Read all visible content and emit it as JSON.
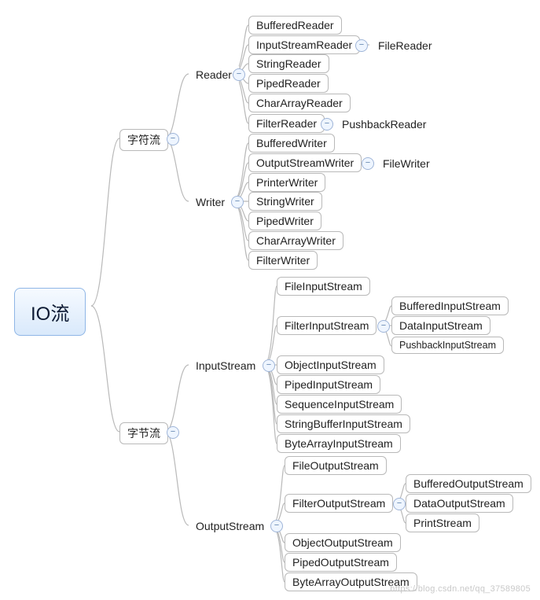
{
  "root": {
    "label": "IO流"
  },
  "charStream": {
    "label": "字符流"
  },
  "reader": {
    "label": "Reader"
  },
  "writer": {
    "label": "Writer"
  },
  "byteStream": {
    "label": "字节流"
  },
  "inputStream": {
    "label": "InputStream"
  },
  "outputStream": {
    "label": "OutputStream"
  },
  "readerChildren": {
    "bufferedReader": "BufferedReader",
    "inputStreamReader": "InputStreamReader",
    "stringReader": "StringReader",
    "pipedReader": "PipedReader",
    "charArrayReader": "CharArrayReader",
    "filterReader": "FilterReader"
  },
  "inputStreamReaderChild": {
    "fileReader": "FileReader"
  },
  "filterReaderChild": {
    "pushbackReader": "PushbackReader"
  },
  "writerChildren": {
    "bufferedWriter": "BufferedWriter",
    "outputStreamWriter": "OutputStreamWriter",
    "printerWriter": "PrinterWriter",
    "stringWriter": "StringWriter",
    "pipedWriter": "PipedWriter",
    "charArrayWriter": "CharArrayWriter",
    "filterWriter": "FilterWriter"
  },
  "outputStreamWriterChild": {
    "fileWriter": "FileWriter"
  },
  "inputStreamChildren": {
    "fileInputStream": "FileInputStream",
    "filterInputStream": "FilterInputStream",
    "objectInputStream": "ObjectInputStream",
    "pipedInputStream": "PipedInputStream",
    "sequenceInputStream": "SequenceInputStream",
    "stringBufferInputStream": "StringBufferInputStream",
    "byteArrayInputStream": "ByteArrayInputStream"
  },
  "filterInputStreamChildren": {
    "bufferedInputStream": "BufferedInputStream",
    "dataInputStream": "DataInputStream",
    "pushbackInputStream": "PushbackInputStream"
  },
  "outputStreamChildren": {
    "fileOutputStream": "FileOutputStream",
    "filterOutputStream": "FilterOutputStream",
    "objectOutputStream": "ObjectOutputStream",
    "pipedOutputStream": "PipedOutputStream",
    "byteArrayOutputStream": "ByteArrayOutputStream"
  },
  "filterOutputStreamChildren": {
    "bufferedOutputStream": "BufferedOutputStream",
    "dataOutputStream": "DataOutputStream",
    "printStream": "PrintStream"
  },
  "watermark": "https://blog.csdn.net/qq_37589805",
  "toggle": {
    "glyph": "−"
  }
}
